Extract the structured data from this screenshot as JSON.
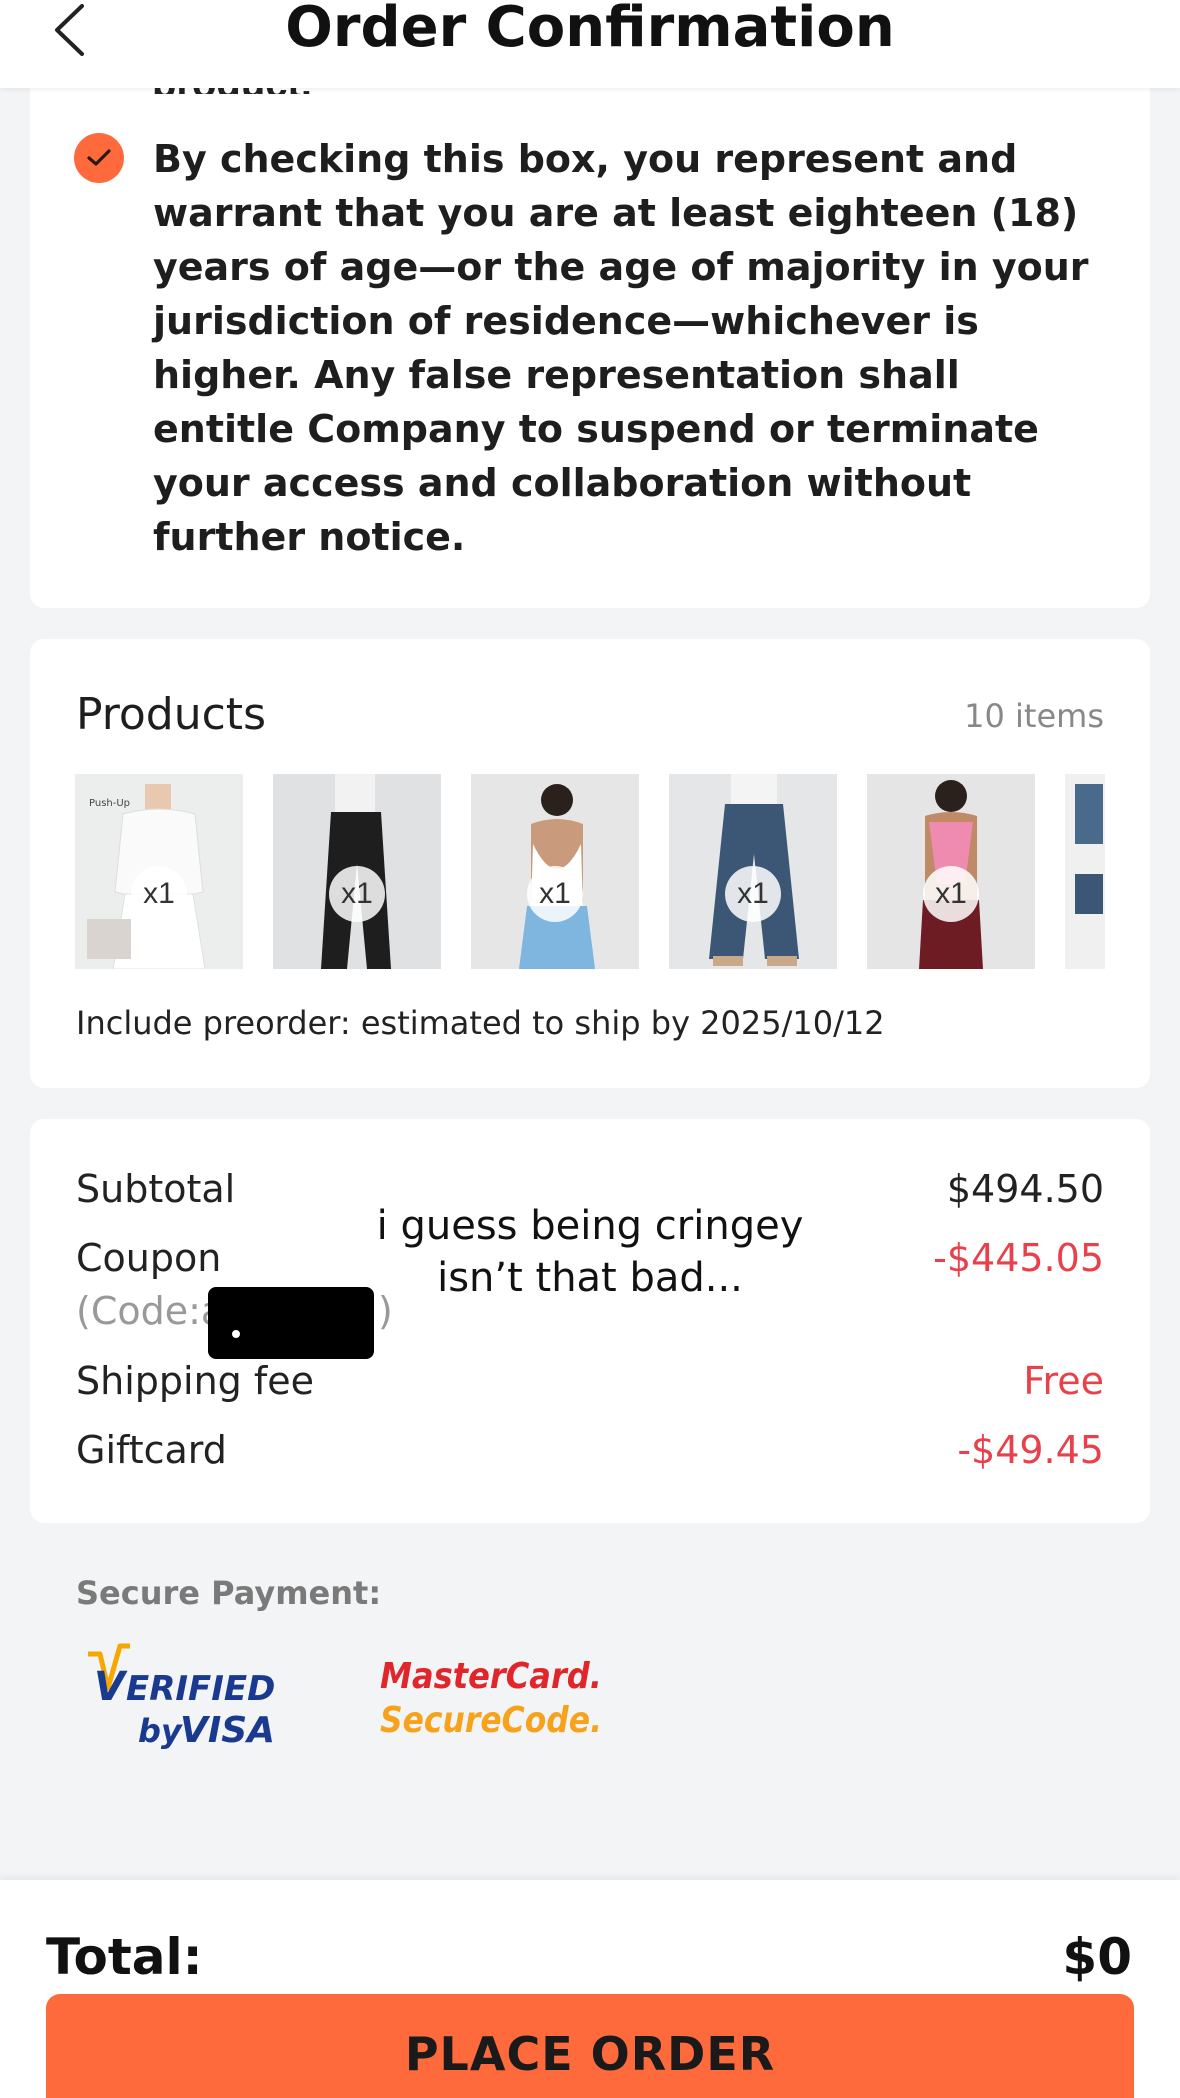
{
  "header": {
    "title": "Order Confirmation",
    "back_icon": "chevron-left-icon"
  },
  "terms": {
    "partial_text": "product.",
    "checked": true,
    "text": "By checking this box, you represent and warrant that you are at least eighteen (18) years of age—or the age of majority in your jurisdiction of residence—whichever is higher. Any false representation shall entitle Company to suspend or terminate your access and collaboration without further notice."
  },
  "products": {
    "title": "Products",
    "count": "10 items",
    "items": [
      {
        "qty": "x1",
        "tag": "Push-Up"
      },
      {
        "qty": "x1"
      },
      {
        "qty": "x1"
      },
      {
        "qty": "x1"
      },
      {
        "qty": "x1"
      }
    ],
    "preorder_note": "Include preorder: estimated to ship by 2025/10/12"
  },
  "summary": {
    "subtotal_label": "Subtotal",
    "subtotal_value": "$494.50",
    "coupon_label": "Coupon",
    "coupon_code_prefix": "(Code:a",
    "coupon_code_suffix": ")",
    "coupon_value": "-$445.05",
    "shipping_label": "Shipping fee",
    "shipping_value": "Free",
    "giftcard_label": "Giftcard",
    "giftcard_value": "-$49.45"
  },
  "caption": "i guess being cringey isn’t that bad...",
  "secure_payment": {
    "label": "Secure Payment:",
    "logos": [
      "verified-by-visa",
      "mastercard-securecode"
    ]
  },
  "footer": {
    "total_label": "Total:",
    "total_value": "$0",
    "place_order_label": "PLACE ORDER"
  },
  "colors": {
    "accent": "#ff6a3d",
    "discount_red": "#e8414b",
    "background": "#f2f4f6"
  }
}
